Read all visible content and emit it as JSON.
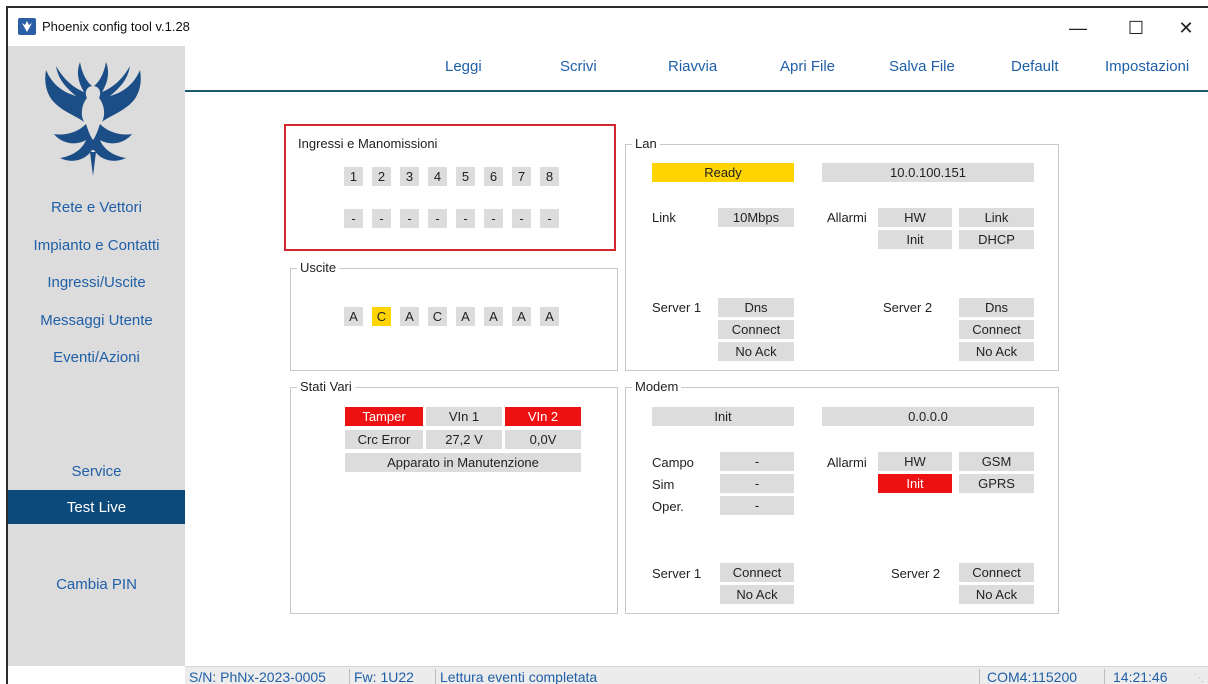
{
  "window": {
    "title": "Phoenix config tool v.1.28"
  },
  "sidebar": {
    "items": [
      "Rete e Vettori",
      "Impianto e Contatti",
      "Ingressi/Uscite",
      "Messaggi Utente",
      "Eventi/Azioni",
      "Service",
      "Test Live",
      "Cambia PIN"
    ],
    "active": "Test Live"
  },
  "menu": [
    "Leggi",
    "Scrivi",
    "Riavvia",
    "Apri File",
    "Salva File",
    "Default",
    "Impostazioni"
  ],
  "ingressi": {
    "title": "Ingressi e Manomissioni",
    "numbers": [
      "1",
      "2",
      "3",
      "4",
      "5",
      "6",
      "7",
      "8"
    ],
    "states": [
      "-",
      "-",
      "-",
      "-",
      "-",
      "-",
      "-",
      "-"
    ]
  },
  "uscite": {
    "title": "Uscite",
    "states": [
      "A",
      "C",
      "A",
      "C",
      "A",
      "A",
      "A",
      "A"
    ],
    "highlighted_index": 1
  },
  "stati": {
    "title": "Stati Vari",
    "row1": [
      "Tamper",
      "VIn 1",
      "VIn 2"
    ],
    "row2": [
      "Crc Error",
      "27,2 V",
      "0,0V"
    ],
    "row3": "Apparato in Manutenzione"
  },
  "lan": {
    "title": "Lan",
    "status": "Ready",
    "ip": "10.0.100.151",
    "link_label": "Link",
    "link_value": "10Mbps",
    "alarms_label": "Allarmi",
    "alarms": [
      "HW",
      "Link",
      "Init",
      "DHCP"
    ],
    "server1_label": "Server 1",
    "server1": [
      "Dns",
      "Connect",
      "No Ack"
    ],
    "server2_label": "Server 2",
    "server2": [
      "Dns",
      "Connect",
      "No Ack"
    ]
  },
  "modem": {
    "title": "Modem",
    "status": "Init",
    "ip": "0.0.0.0",
    "labels": [
      "Campo",
      "Sim",
      "Oper."
    ],
    "values": [
      "-",
      "-",
      "-"
    ],
    "alarms_label": "Allarmi",
    "alarms": [
      "HW",
      "GSM",
      "Init",
      "GPRS"
    ],
    "server1_label": "Server 1",
    "server1": [
      "Connect",
      "No Ack"
    ],
    "server2_label": "Server 2",
    "server2": [
      "Connect",
      "No Ack"
    ]
  },
  "statusbar": {
    "serial": "S/N: PhNx-2023-0005",
    "firmware": "Fw: 1U22",
    "message": "Lettura eventi completata",
    "port": "COM4:115200",
    "time": "14:21:46"
  },
  "colors": {
    "accent": "#1f5fa8",
    "active_nav": "#0d4a7c",
    "ok_yellow": "#ffd400",
    "alarm_red": "#ee1111"
  }
}
